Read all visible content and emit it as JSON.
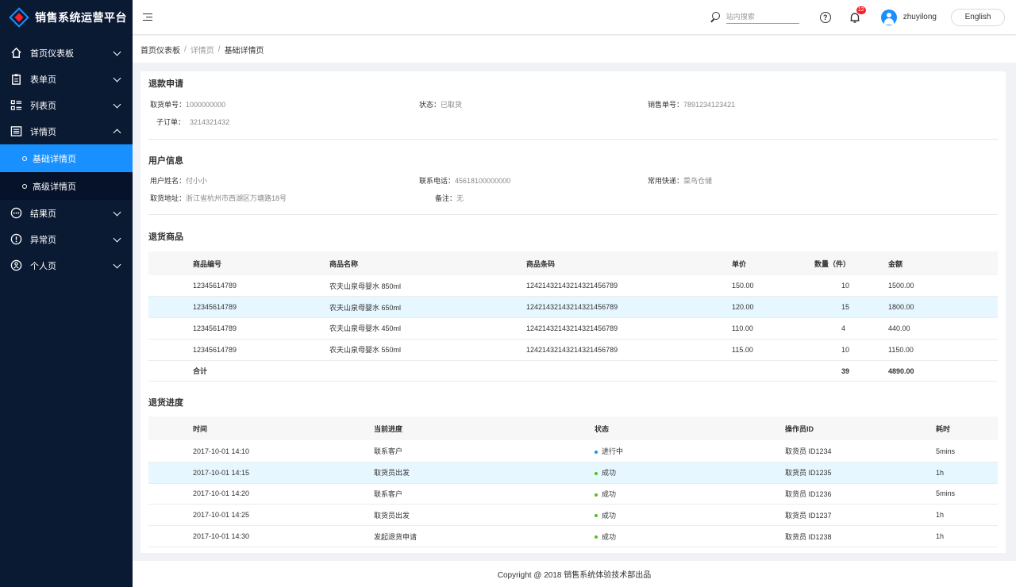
{
  "app": {
    "title": "销售系统运营平台"
  },
  "sidebar": {
    "items": [
      {
        "label": "首页仪表板",
        "icon": "home-icon"
      },
      {
        "label": "表单页",
        "icon": "clipboard-icon"
      },
      {
        "label": "列表页",
        "icon": "list-grid-icon"
      },
      {
        "label": "详情页",
        "icon": "detail-list-icon"
      },
      {
        "label": "结果页",
        "icon": "more-circle-icon"
      },
      {
        "label": "异常页",
        "icon": "warning-circle-icon"
      },
      {
        "label": "个人页",
        "icon": "person-icon"
      }
    ],
    "sub_items": [
      {
        "label": "基础详情页",
        "active": true
      },
      {
        "label": "高级详情页",
        "active": false
      }
    ]
  },
  "header": {
    "search_placeholder": "站内搜索",
    "notification_count": "12",
    "username": "zhuyilong",
    "language_button": "English"
  },
  "breadcrumb": [
    "首页仪表板",
    "详情页",
    "基础详情页"
  ],
  "refund": {
    "title": "退款申请",
    "fields": [
      {
        "label": "取货单号：",
        "value": "1000000000"
      },
      {
        "label": "状态：",
        "value": "已取货"
      },
      {
        "label": "销售单号：",
        "value": "7891234123421"
      },
      {
        "label": "子订单：",
        "value": "3214321432"
      }
    ]
  },
  "user_info": {
    "title": "用户信息",
    "fields": [
      {
        "label": "用户姓名：",
        "value": "付小小"
      },
      {
        "label": "联系电话：",
        "value": "45618100000000"
      },
      {
        "label": "常用快递：",
        "value": "菜鸟仓储"
      },
      {
        "label": "取货地址：",
        "value": "浙江省杭州市西湖区万塘路18号"
      },
      {
        "label": "备注：",
        "value": "无"
      }
    ]
  },
  "goods": {
    "title": "退货商品",
    "columns": [
      "商品编号",
      "商品名称",
      "商品条码",
      "单价",
      "数量（件）",
      "金额"
    ],
    "rows": [
      [
        "12345614789",
        "农夫山泉母婴水 850ml",
        "1242143214321432145​6789",
        "150.00",
        "10",
        "1500.00"
      ],
      [
        "12345614789",
        "农夫山泉母婴水 650ml",
        "12421432143214321456789",
        "120.00",
        "15",
        "1800.00"
      ],
      [
        "12345614789",
        "农夫山泉母婴水 450ml",
        "12421432143214321456789",
        "110.00",
        "4",
        "440.00"
      ],
      [
        "12345614789",
        "农夫山泉母婴水 550ml",
        "12421432143214321456789",
        "115.00",
        "10",
        "1150.00"
      ]
    ],
    "total": {
      "label": "合计",
      "quantity": "39",
      "amount": "4890.00"
    }
  },
  "progress": {
    "title": "退货进度",
    "columns": [
      "时间",
      "当前进度",
      "状态",
      "操作员ID",
      "耗时"
    ],
    "rows": [
      [
        "2017-10-01 14:10",
        "联系客户",
        "进行中",
        "取货员 ID1234",
        "5mins"
      ],
      [
        "2017-10-01 14:15",
        "取货员出发",
        "成功",
        "取货员 ID1235",
        "1h"
      ],
      [
        "2017-10-01 14:20",
        "联系客户",
        "成功",
        "取货员 ID1236",
        "5mins"
      ],
      [
        "2017-10-01 14:25",
        "取货员出发",
        "成功",
        "取货员 ID1237",
        "1h"
      ],
      [
        "2017-10-01 14:30",
        "发起退货申请",
        "成功",
        "取货员 ID1238",
        "1h"
      ]
    ],
    "status_colors": {
      "进行中": "#1890ff",
      "成功": "#52c41a"
    }
  },
  "footer": {
    "text": "Copyright @ 2018 销售系统体验技术部出品"
  },
  "colors": {
    "sidebar_bg": "#0b1a33",
    "accent": "#1890ff",
    "row_highlight": "#e6f7ff",
    "badge": "#f5222d"
  }
}
